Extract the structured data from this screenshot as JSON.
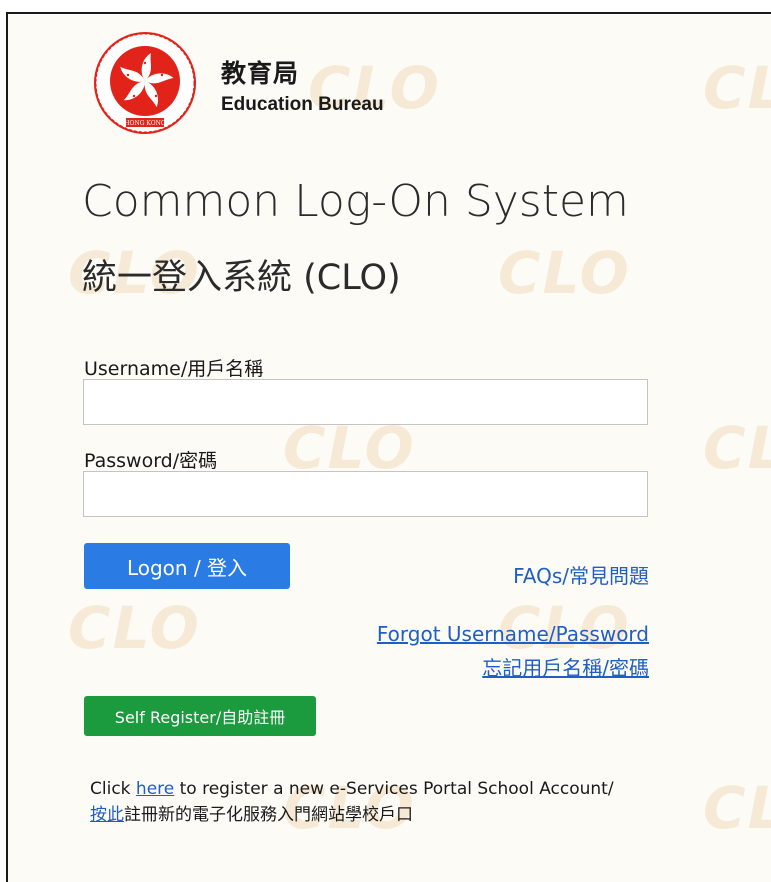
{
  "brand": {
    "bureau_zh": "教育局",
    "bureau_en": "Education Bureau",
    "emblem_text": "HONG KONG",
    "watermark": "CLO"
  },
  "title": {
    "en": "Common Log-On System",
    "zh": "統一登入系統 (CLO)"
  },
  "form": {
    "username_label": "Username/用戶名稱",
    "username_value": "",
    "password_label": "Password/密碼",
    "password_value": ""
  },
  "actions": {
    "logon_label": "Logon / 登入",
    "faq_label": "FAQs/常見問題",
    "forgot_en": "Forgot Username/Password",
    "forgot_zh": "忘記用戶名稱/密碼",
    "self_register_label": "Self Register/自助註冊"
  },
  "note": {
    "prefix": "Click ",
    "here_link": "here",
    "suffix": " to register a new e-Services Portal School Account/",
    "zh_link": "按此",
    "zh_suffix": "註冊新的電子化服務入門網站學校戶口"
  },
  "colors": {
    "logon_button": "#2a7be3",
    "register_button": "#1c9a3e",
    "link": "#1f5fc4",
    "emblem_red": "#e2231a",
    "background": "#fdfbf6"
  }
}
